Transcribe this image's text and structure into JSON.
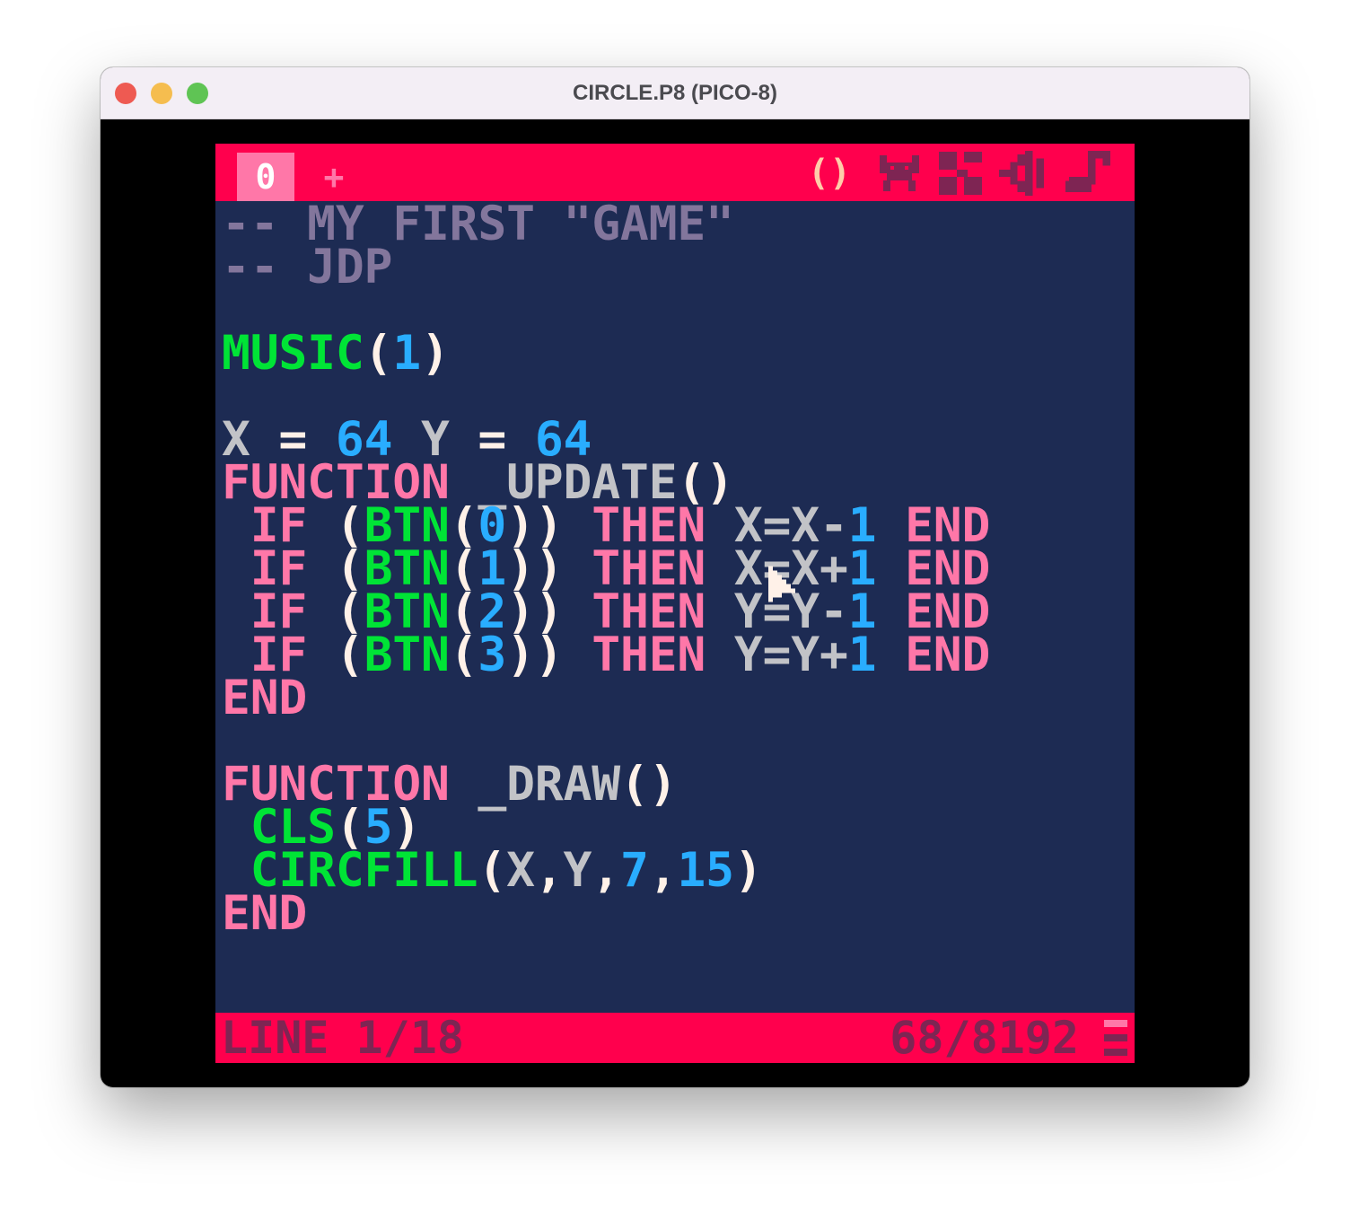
{
  "window": {
    "title": "CIRCLE.P8 (PICO-8)"
  },
  "tabs": {
    "active": "0",
    "add": "+"
  },
  "editors": {
    "code": "()"
  },
  "code_lines": [
    [
      [
        "c-com",
        "-- MY FIRST \"GAME\""
      ]
    ],
    [
      [
        "c-com",
        "-- JDP"
      ]
    ],
    [],
    [
      [
        "c-fn",
        "MUSIC"
      ],
      [
        "c-pun",
        "("
      ],
      [
        "c-num",
        "1"
      ],
      [
        "c-pun",
        ")"
      ]
    ],
    [],
    [
      [
        "c-var",
        "X"
      ],
      [
        "c-pun",
        " = "
      ],
      [
        "c-num",
        "64"
      ],
      [
        "c-var",
        " Y"
      ],
      [
        "c-pun",
        " = "
      ],
      [
        "c-num",
        "64"
      ]
    ],
    [
      [
        "c-kw",
        "FUNCTION"
      ],
      [
        "c-var",
        " _UPDATE"
      ],
      [
        "c-pun",
        "()"
      ]
    ],
    [
      [
        "c-kw",
        " IF"
      ],
      [
        "c-pun",
        " ("
      ],
      [
        "c-fn",
        "BTN"
      ],
      [
        "c-pun",
        "("
      ],
      [
        "c-num",
        "0"
      ],
      [
        "c-pun",
        ")) "
      ],
      [
        "c-kw",
        "THEN"
      ],
      [
        "c-var",
        " X=X-"
      ],
      [
        "c-num",
        "1"
      ],
      [
        "c-kw",
        " END"
      ]
    ],
    [
      [
        "c-kw",
        " IF"
      ],
      [
        "c-pun",
        " ("
      ],
      [
        "c-fn",
        "BTN"
      ],
      [
        "c-pun",
        "("
      ],
      [
        "c-num",
        "1"
      ],
      [
        "c-pun",
        ")) "
      ],
      [
        "c-kw",
        "THEN"
      ],
      [
        "c-var",
        " X=X+"
      ],
      [
        "c-num",
        "1"
      ],
      [
        "c-kw",
        " END"
      ]
    ],
    [
      [
        "c-kw",
        " IF"
      ],
      [
        "c-pun",
        " ("
      ],
      [
        "c-fn",
        "BTN"
      ],
      [
        "c-pun",
        "("
      ],
      [
        "c-num",
        "2"
      ],
      [
        "c-pun",
        ")) "
      ],
      [
        "c-kw",
        "THEN"
      ],
      [
        "c-var",
        " Y=Y-"
      ],
      [
        "c-num",
        "1"
      ],
      [
        "c-kw",
        " END"
      ]
    ],
    [
      [
        "c-kw",
        " IF"
      ],
      [
        "c-pun",
        " ("
      ],
      [
        "c-fn",
        "BTN"
      ],
      [
        "c-pun",
        "("
      ],
      [
        "c-num",
        "3"
      ],
      [
        "c-pun",
        ")) "
      ],
      [
        "c-kw",
        "THEN"
      ],
      [
        "c-var",
        " Y=Y+"
      ],
      [
        "c-num",
        "1"
      ],
      [
        "c-kw",
        " END"
      ]
    ],
    [
      [
        "c-kw",
        "END"
      ]
    ],
    [],
    [
      [
        "c-kw",
        "FUNCTION"
      ],
      [
        "c-var",
        " _DRAW"
      ],
      [
        "c-pun",
        "()"
      ]
    ],
    [
      [
        "c-fn",
        " CLS"
      ],
      [
        "c-pun",
        "("
      ],
      [
        "c-num",
        "5"
      ],
      [
        "c-pun",
        ")"
      ]
    ],
    [
      [
        "c-fn",
        " CIRCFILL"
      ],
      [
        "c-pun",
        "("
      ],
      [
        "c-var",
        "X"
      ],
      [
        "c-pun",
        ","
      ],
      [
        "c-var",
        "Y"
      ],
      [
        "c-pun",
        ","
      ],
      [
        "c-num",
        "7"
      ],
      [
        "c-pun",
        ","
      ],
      [
        "c-num",
        "15"
      ],
      [
        "c-pun",
        ")"
      ]
    ],
    [
      [
        "c-kw",
        "END"
      ]
    ]
  ],
  "status": {
    "line": "LINE 1/18",
    "tokens": "68/8192"
  },
  "colors": {
    "background": "#1d2b53",
    "bar": "#ff004d",
    "comment": "#83769c",
    "keyword": "#ff77a8",
    "function": "#00e436",
    "number": "#29adff",
    "variable": "#c2c3c7",
    "punctuation": "#fff1e8",
    "inactive_icon": "#7e2553",
    "active_icon": "#ffccaa"
  },
  "icons": [
    "code-editor-icon",
    "sprite-editor-icon",
    "map-editor-icon",
    "sfx-editor-icon",
    "music-editor-icon",
    "menu-icon",
    "mouse-cursor-icon"
  ]
}
